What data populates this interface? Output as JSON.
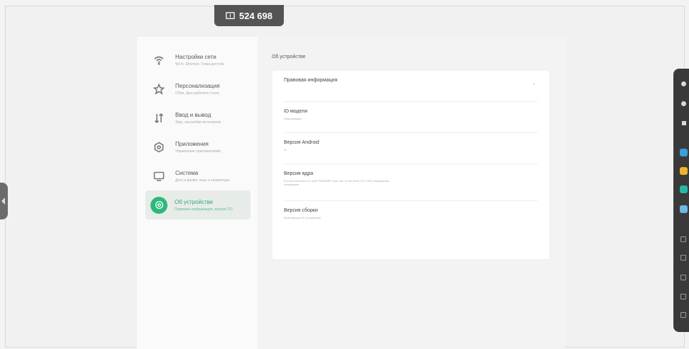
{
  "badge": {
    "code": "524 698",
    "icon": "screen-share-icon"
  },
  "sidebar": {
    "items": [
      {
        "title": "Настройки сети",
        "subtitle": "Wi-Fi, Ethernet, Точка доступа",
        "icon": "wifi-icon",
        "active": false
      },
      {
        "title": "Персонализация",
        "subtitle": "Обои, фон рабочего стола",
        "icon": "star-icon",
        "active": false
      },
      {
        "title": "Ввод и вывод",
        "subtitle": "Звук, настройки источников",
        "icon": "io-arrows-icon",
        "active": false
      },
      {
        "title": "Приложения",
        "subtitle": "Управление приложениями",
        "icon": "apps-hexagon-icon",
        "active": false
      },
      {
        "title": "Система",
        "subtitle": "Дата и время, язык и клавиатура",
        "icon": "monitor-icon",
        "active": false
      },
      {
        "title": "Об устройстве",
        "subtitle": "Правовая информация, версия ПО",
        "icon": "info-circle-icon",
        "active": true
      }
    ]
  },
  "content": {
    "title": "Об устройстве",
    "rows": [
      {
        "title": "Правовая информация",
        "subtitle": "",
        "has_arrow": true
      },
      {
        "title": "ID модели",
        "subtitle": "Информация",
        "has_arrow": false
      },
      {
        "title": "Версия Android",
        "subtitle": "11",
        "has_arrow": false
      },
      {
        "title": "Версия ядра",
        "subtitle": "5.4.125-android11 #1 SMP PREEMPT Mon Jan 10 18:23:51 CST 2022 аппаратная платформа",
        "has_arrow": false
      },
      {
        "title": "Версия сборки",
        "subtitle": "Build версия ОС устройства",
        "has_arrow": false
      }
    ]
  },
  "toolbar": {
    "buttons": [
      {
        "name": "settings-icon",
        "kind": "dot"
      },
      {
        "name": "home-icon",
        "kind": "dot"
      },
      {
        "name": "stop-icon",
        "kind": "sq"
      },
      {
        "name": "app-blue-icon",
        "kind": "app",
        "color": "#3a9fe0"
      },
      {
        "name": "app-yellow-icon",
        "kind": "app",
        "color": "#f0b22a"
      },
      {
        "name": "app-teal-icon",
        "kind": "app",
        "color": "#27b7a5"
      },
      {
        "name": "app-lightblue-icon",
        "kind": "app",
        "color": "#6fb7e8"
      },
      {
        "name": "window-icon",
        "kind": "mini"
      },
      {
        "name": "edit-icon",
        "kind": "mini"
      },
      {
        "name": "gallery-icon",
        "kind": "mini"
      },
      {
        "name": "document-icon",
        "kind": "mini"
      },
      {
        "name": "layers-icon",
        "kind": "mini"
      }
    ]
  },
  "colors": {
    "accent": "#2fb87e",
    "toolbar": "#3a3a3a"
  }
}
